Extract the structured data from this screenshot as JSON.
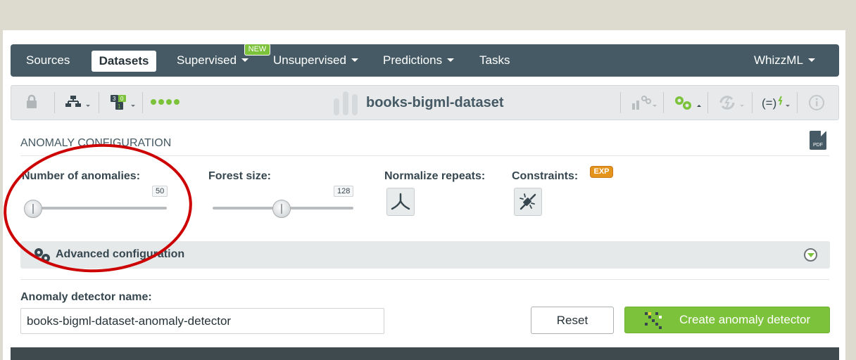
{
  "nav": {
    "items": [
      {
        "label": "Sources"
      },
      {
        "label": "Datasets"
      },
      {
        "label": "Supervised"
      },
      {
        "label": "Unsupervised"
      },
      {
        "label": "Predictions"
      },
      {
        "label": "Tasks"
      },
      {
        "label": "WhizzML"
      }
    ],
    "active": "Datasets",
    "new_badge": "NEW"
  },
  "toolbar": {
    "dataset_name": "books-bigml-dataset",
    "icons": [
      "lock-icon",
      "tree-icon",
      "dataset-badge-icon",
      "status-dots",
      "scatter-icon",
      "gears-icon",
      "refresh-icon",
      "formula-icon",
      "info-icon"
    ],
    "status_color": "#7cc23a"
  },
  "config": {
    "section_title": "ANOMALY CONFIGURATION",
    "pdf_label": "PDF",
    "num_anomalies": {
      "label": "Number of anomalies:",
      "value": "50"
    },
    "forest_size": {
      "label": "Forest size:",
      "value": "128"
    },
    "normalize": {
      "label": "Normalize repeats:"
    },
    "constraints": {
      "label": "Constraints:",
      "badge": "EXP"
    },
    "advanced": {
      "label": "Advanced configuration"
    }
  },
  "form": {
    "name_label": "Anomaly detector name:",
    "name_value": "books-bigml-dataset-anomaly-detector",
    "reset_label": "Reset",
    "create_label": "Create anomaly detector"
  },
  "colors": {
    "nav_bg": "#455a64",
    "accent": "#7cc23a",
    "annotation": "#cc0000",
    "exp_badge": "#e4931b"
  }
}
